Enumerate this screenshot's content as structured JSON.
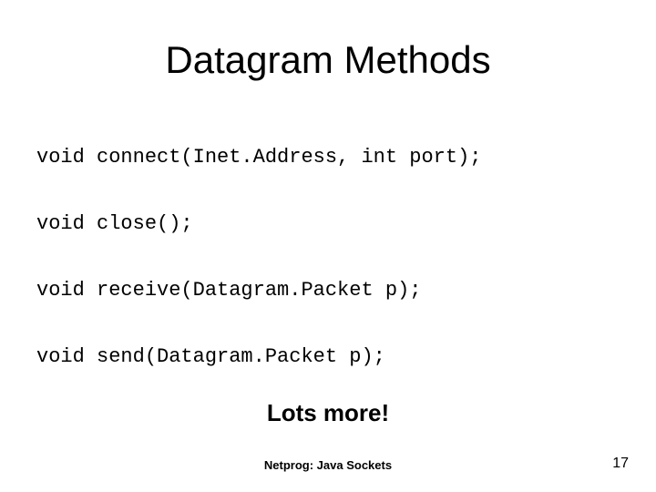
{
  "title": "Datagram Methods",
  "code_lines": [
    "void connect(Inet.Address, int port);",
    "void close();",
    "void receive(Datagram.Packet p);",
    "void send(Datagram.Packet p);"
  ],
  "lots_more": "Lots more!",
  "footer": "Netprog: Java Sockets",
  "page_number": "17"
}
